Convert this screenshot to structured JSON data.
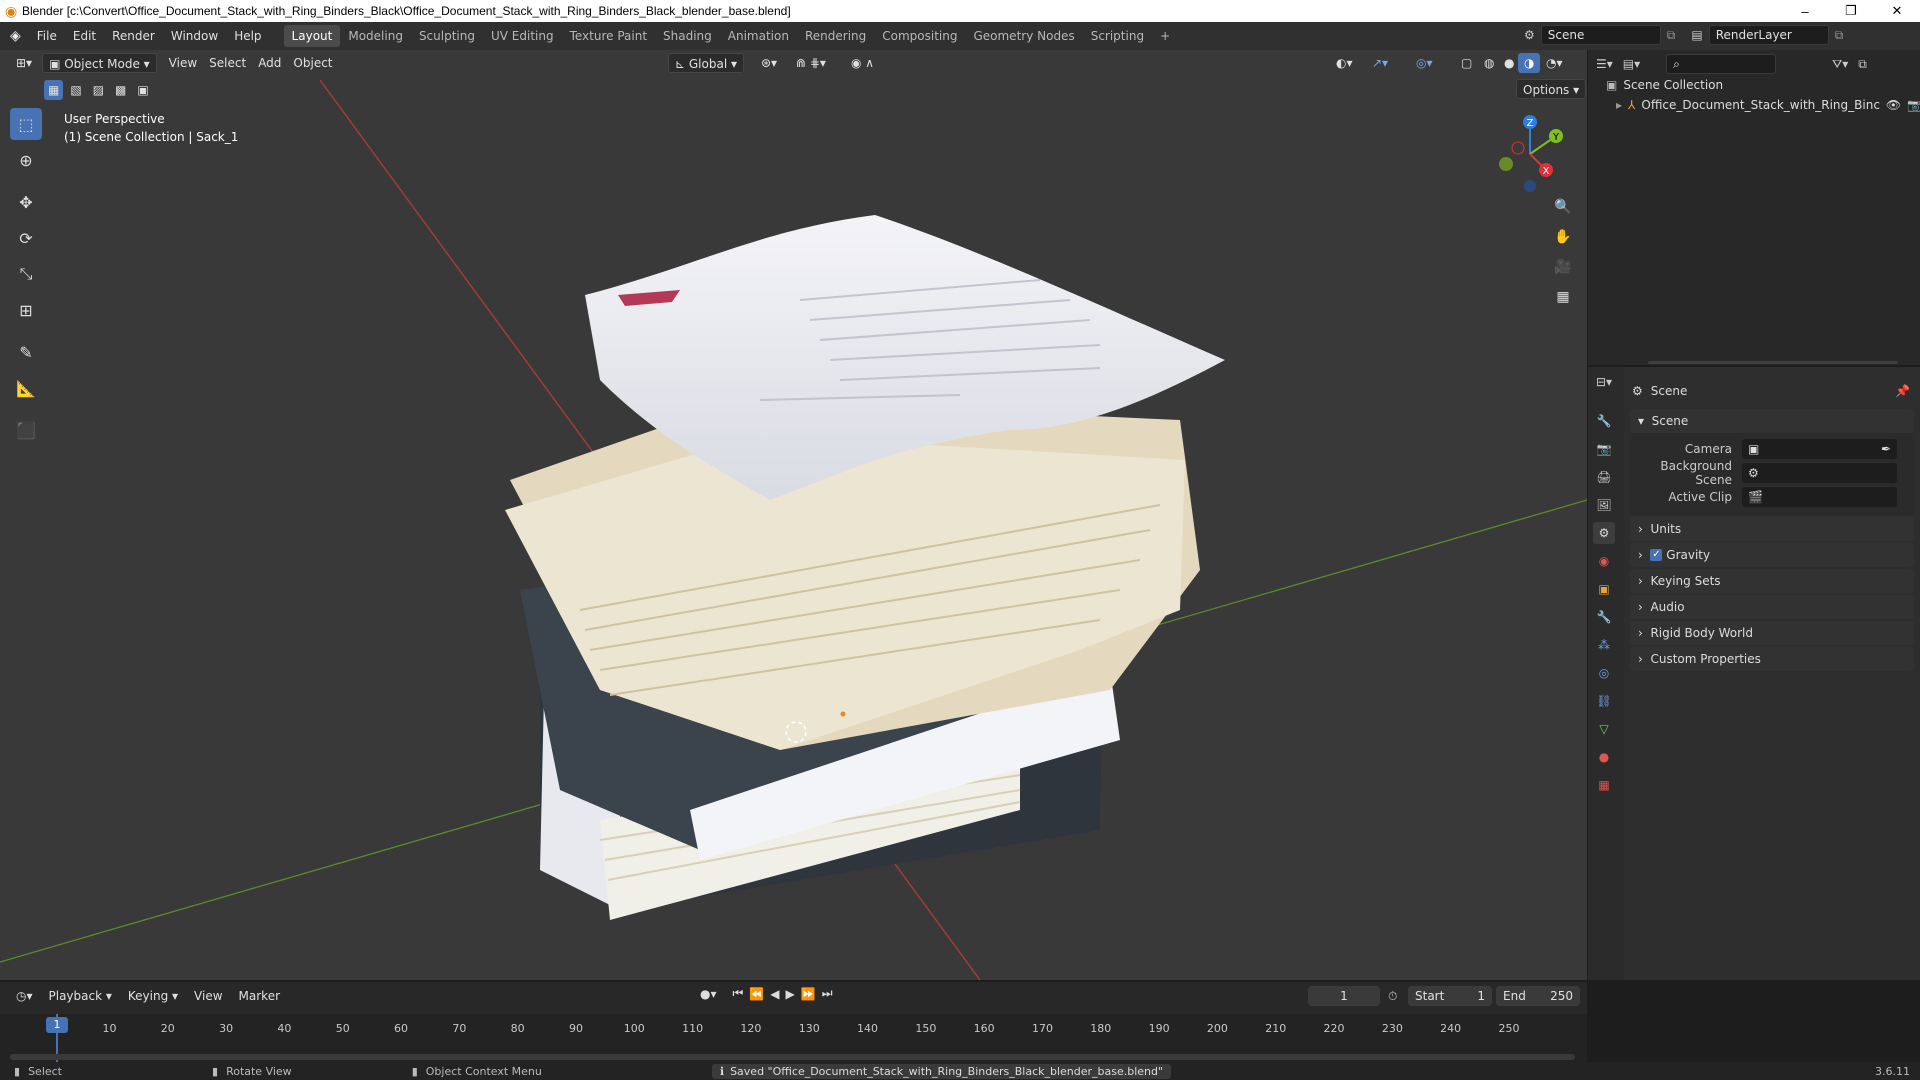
{
  "window": {
    "title": "Blender [c:\\Convert\\Office_Document_Stack_with_Ring_Binders_Black\\Office_Document_Stack_with_Ring_Binders_Black_blender_base.blend]",
    "minimize": "–",
    "maximize": "❐",
    "close": "✕"
  },
  "menu": {
    "items": [
      "File",
      "Edit",
      "Render",
      "Window",
      "Help"
    ],
    "workspaces": [
      "Layout",
      "Modeling",
      "Sculpting",
      "UV Editing",
      "Texture Paint",
      "Shading",
      "Animation",
      "Rendering",
      "Compositing",
      "Geometry Nodes",
      "Scripting"
    ],
    "add_workspace": "+",
    "scene_label": "Scene",
    "render_layer": "RenderLayer"
  },
  "viewport": {
    "mode": "Object Mode",
    "menus": [
      "View",
      "Select",
      "Add",
      "Object"
    ],
    "transform_orientation": "Global",
    "options": "Options",
    "overlay_line1": "User Perspective",
    "overlay_line2": "(1) Scene Collection | Sack_1",
    "gizmo_axes": {
      "x": "X",
      "y": "Y",
      "z": "Z"
    }
  },
  "outliner": {
    "root": "Scene Collection",
    "object": "Office_Document_Stack_with_Ring_Binc"
  },
  "properties": {
    "header": "Scene",
    "panel": "Scene",
    "fields": [
      {
        "label": "Camera",
        "value": ""
      },
      {
        "label": "Background Scene",
        "value": ""
      },
      {
        "label": "Active Clip",
        "value": ""
      }
    ],
    "sections": [
      "Units",
      "Gravity",
      "Keying Sets",
      "Audio",
      "Rigid Body World",
      "Custom Properties"
    ],
    "gravity_enabled": true
  },
  "timeline": {
    "menus": [
      "Playback",
      "Keying",
      "View",
      "Marker"
    ],
    "current_frame": "1",
    "start_label": "Start",
    "start": "1",
    "end_label": "End",
    "end": "250",
    "ticks": [
      "1",
      "10",
      "20",
      "30",
      "40",
      "50",
      "60",
      "70",
      "80",
      "90",
      "100",
      "110",
      "120",
      "130",
      "140",
      "150",
      "160",
      "170",
      "180",
      "190",
      "200",
      "210",
      "220",
      "230",
      "240",
      "250"
    ]
  },
  "status": {
    "select": "Select",
    "rotate": "Rotate View",
    "context": "Object Context Menu",
    "message": "Saved \"Office_Document_Stack_with_Ring_Binders_Black_blender_base.blend\"",
    "version": "3.6.11"
  },
  "colors": {
    "accent": "#4772b3",
    "x_axis": "#e0303a",
    "y_axis": "#7fbf1f",
    "z_axis": "#2f7fe0"
  }
}
